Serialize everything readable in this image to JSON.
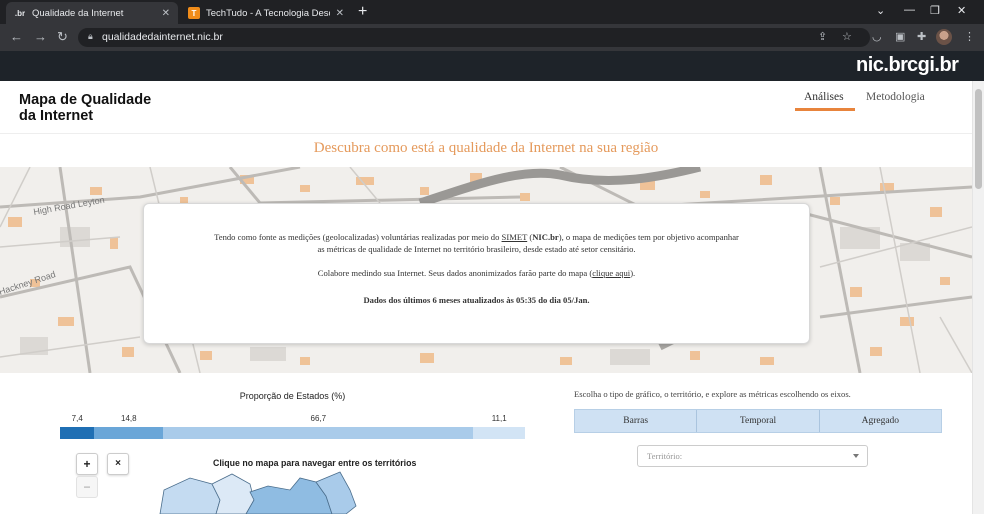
{
  "browser": {
    "tabs": [
      {
        "favicon": ".br",
        "title": "Qualidade da Internet",
        "active": true
      },
      {
        "favicon": "T",
        "title": "TechTudo - A Tecnologia Descom",
        "active": false
      }
    ],
    "url": "qualidadedainternet.nic.br"
  },
  "site": {
    "logos": [
      "nic.br",
      "cgi.br"
    ],
    "title": "Mapa de Qualidade da Internet",
    "nav": [
      {
        "label": "Análises",
        "active": true
      },
      {
        "label": "Metodologia",
        "active": false
      }
    ],
    "headline": "Descubra como está a qualidade da Internet na sua região",
    "accent_color": "#e8843c"
  },
  "banner": {
    "map_labels": [
      "High Road Leyton",
      "Hackney Road"
    ],
    "intro_before": "Tendo como fonte as medições (geolocalizadas) voluntárias realizadas por meio do",
    "intro_link": "SIMET",
    "intro_org": "NIC.br",
    "intro_after": ", o mapa de medições tem por objetivo acompanhar",
    "intro_line2": "as métricas de qualidade de Internet no território brasileiro, desde estado até setor censitário.",
    "collab_before": "Colabore medindo sua Internet. Seus dados anonimizados farão parte do mapa (",
    "collab_link": "clique aqui",
    "collab_after": ").",
    "update_note": "Dados dos últimos 6 meses atualizados às 05:35 do dia 05/Jan."
  },
  "proportion": {
    "title": "Proporção de Estados (%)",
    "segments": [
      {
        "label": "7,4",
        "value": 7.4,
        "color": "#1f6fb4"
      },
      {
        "label": "14,8",
        "value": 14.8,
        "color": "#6aa6d8"
      },
      {
        "label": "66,7",
        "value": 66.7,
        "color": "#a9cbea"
      },
      {
        "label": "11,1",
        "value": 11.1,
        "color": "#d2e4f5"
      }
    ]
  },
  "map_panel": {
    "zoom_in": "+",
    "reset": "×",
    "zoom_out": "−",
    "hint": "Clique no mapa para navegar entre os territórios"
  },
  "chart_panel": {
    "intro": "Escolha o tipo de gráfico, o território, e explore as métricas escolhendo os eixos.",
    "chart_types": [
      "Barras",
      "Temporal",
      "Agregado"
    ],
    "territory_placeholder": "Território:"
  }
}
